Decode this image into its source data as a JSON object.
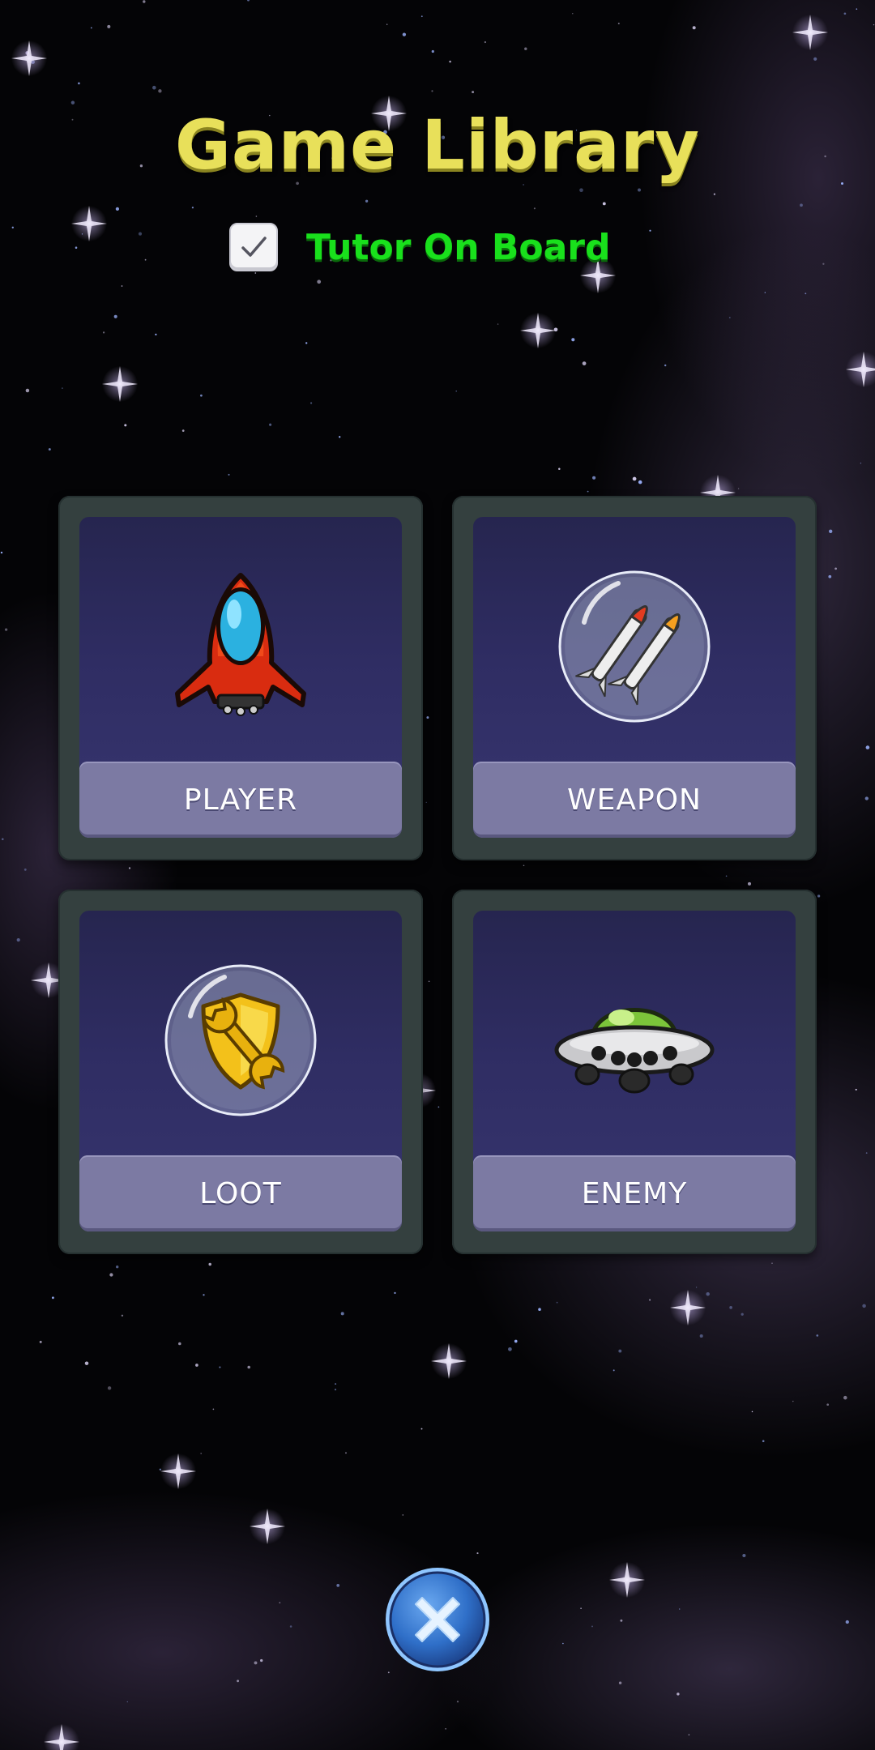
{
  "header": {
    "title": "Game Library"
  },
  "tutor": {
    "label": "Tutor On Board",
    "checked": true
  },
  "cards": [
    {
      "label": "PLAYER",
      "icon": "red-rocket-ship-icon"
    },
    {
      "label": "WEAPON",
      "icon": "missiles-bubble-icon"
    },
    {
      "label": "LOOT",
      "icon": "shield-wrench-bubble-icon"
    },
    {
      "label": "ENEMY",
      "icon": "green-ufo-icon"
    }
  ],
  "close": {
    "icon": "close-x-icon"
  },
  "colors": {
    "title": "#e8e05a",
    "tutor_label": "#19e01c",
    "card_frame": "#34403f",
    "card_panel": "#2f2d63",
    "label_box": "#7c7aa3",
    "close_button": "#2f6fc8"
  }
}
